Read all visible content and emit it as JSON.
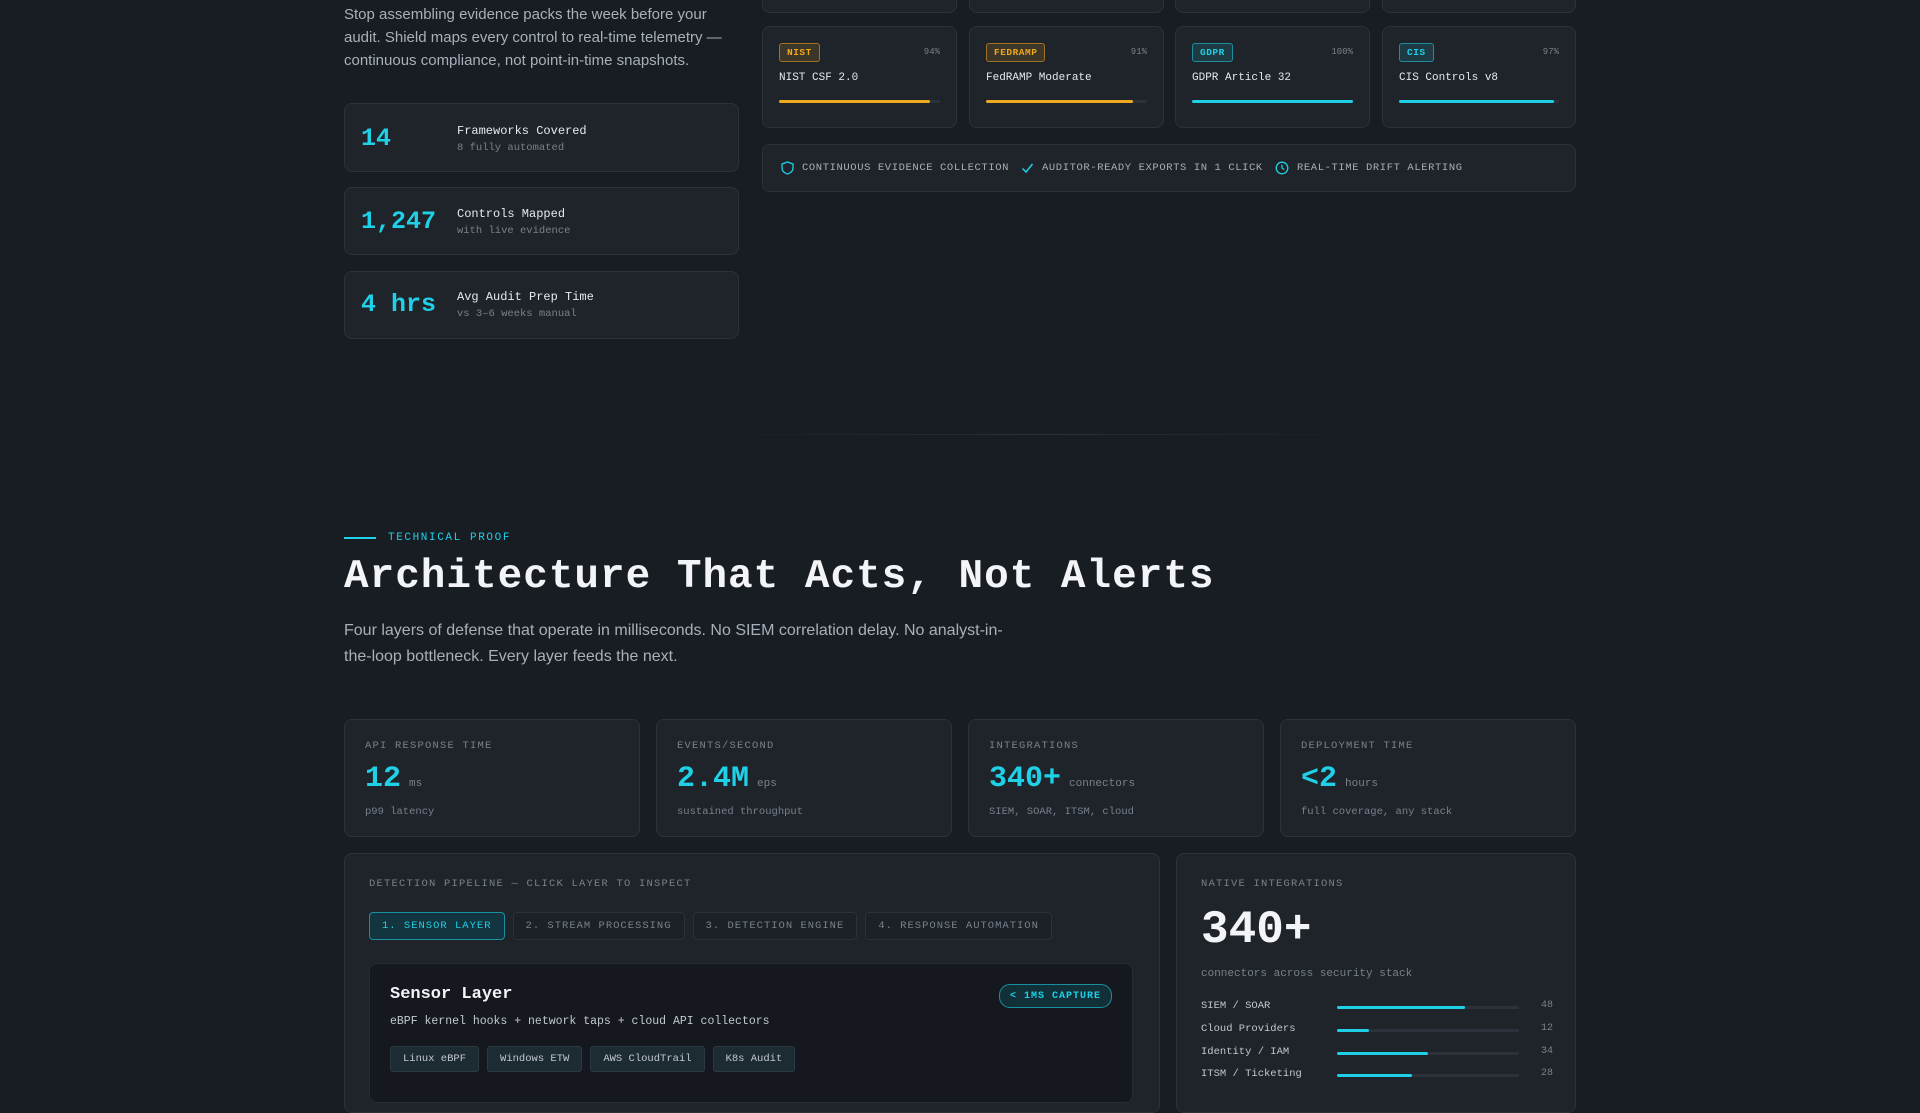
{
  "intro": {
    "text": "Stop assembling evidence packs the week before your audit. Shield maps every control to real-time telemetry — continuous compliance, not point-in-time snapshots."
  },
  "stats": [
    {
      "value": "14",
      "label": "Frameworks Covered",
      "sub": "8 fully automated"
    },
    {
      "value": "1,247",
      "label": "Controls Mapped",
      "sub": "with live evidence"
    },
    {
      "value": "4 hrs",
      "label": "Avg Audit Prep Time",
      "sub": "vs 3–6 weeks manual"
    }
  ],
  "frameworks": [
    {
      "badge": "NIST",
      "name": "NIST CSF 2.0",
      "pct": "94%",
      "progress": 0.94,
      "color": "#f0a81e"
    },
    {
      "badge": "FEDRAMP",
      "name": "FedRAMP Moderate",
      "pct": "91%",
      "progress": 0.91,
      "color": "#f0a81e"
    },
    {
      "badge": "GDPR",
      "name": "GDPR Article 32",
      "pct": "100%",
      "progress": 1.0,
      "color": "#1fd0e6"
    },
    {
      "badge": "CIS",
      "name": "CIS Controls v8",
      "pct": "97%",
      "progress": 0.97,
      "color": "#1fd0e6"
    }
  ],
  "features": [
    {
      "icon": "shield-icon",
      "text": "CONTINUOUS EVIDENCE COLLECTION"
    },
    {
      "icon": "check-icon",
      "text": "AUDITOR-READY EXPORTS IN 1 CLICK"
    },
    {
      "icon": "clock-icon",
      "text": "REAL-TIME DRIFT ALERTING"
    }
  ],
  "section": {
    "eyebrow": "TECHNICAL PROOF",
    "title": "Architecture That Acts, Not Alerts",
    "lede": "Four layers of defense that operate in milliseconds. No SIEM correlation delay. No analyst-in-the-loop bottleneck. Every layer feeds the next."
  },
  "metrics": [
    {
      "caption": "API RESPONSE TIME",
      "value": "12",
      "unit": "ms",
      "sub": "p99 latency"
    },
    {
      "caption": "EVENTS/SECOND",
      "value": "2.4M",
      "unit": "eps",
      "sub": "sustained throughput"
    },
    {
      "caption": "INTEGRATIONS",
      "value": "340+",
      "unit": "connectors",
      "sub": "SIEM, SOAR, ITSM, cloud"
    },
    {
      "caption": "DEPLOYMENT TIME",
      "value": "<2",
      "unit": "hours",
      "sub": "full coverage, any stack"
    }
  ],
  "pipeline": {
    "title": "DETECTION PIPELINE — CLICK LAYER TO INSPECT",
    "tabs": [
      "1. SENSOR LAYER",
      "2. STREAM PROCESSING",
      "3. DETECTION ENGINE",
      "4. RESPONSE AUTOMATION"
    ],
    "active_tab": 0,
    "panel": {
      "title": "Sensor Layer",
      "description": "eBPF kernel hooks + network taps + cloud API collectors",
      "badge": "< 1MS CAPTURE",
      "chips": [
        "Linux eBPF",
        "Windows ETW",
        "AWS CloudTrail",
        "K8s Audit"
      ]
    }
  },
  "integrations": {
    "title": "NATIVE INTEGRATIONS",
    "count": "340+",
    "subtitle": "connectors across security stack",
    "rows": [
      {
        "name": "SIEM / SOAR",
        "count": "48",
        "value": 48
      },
      {
        "name": "Cloud Providers",
        "count": "12",
        "value": 12
      },
      {
        "name": "Identity / IAM",
        "count": "34",
        "value": 34
      },
      {
        "name": "ITSM / Ticketing",
        "count": "28",
        "value": 28
      }
    ],
    "bar_max": 68,
    "accent": "#1fd0e6"
  }
}
